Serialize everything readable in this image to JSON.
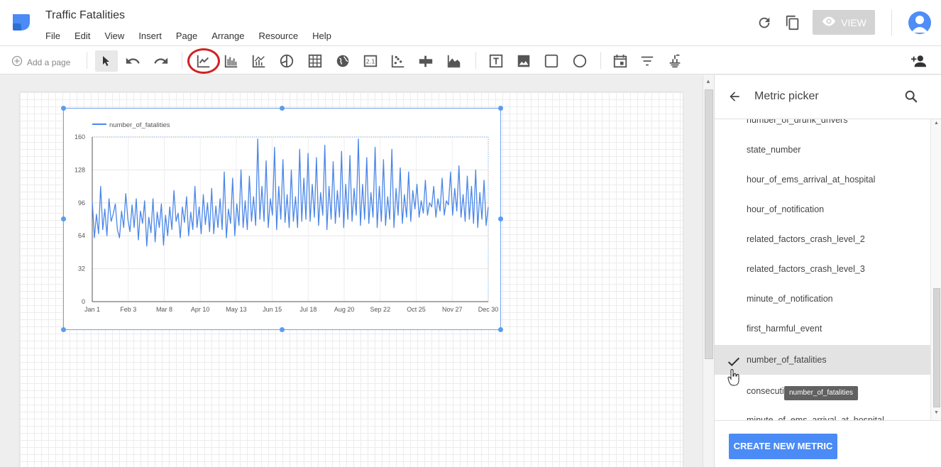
{
  "app": {
    "title": "Traffic Fatalities",
    "menu": [
      "File",
      "Edit",
      "View",
      "Insert",
      "Page",
      "Arrange",
      "Resource",
      "Help"
    ],
    "view_label": "VIEW"
  },
  "toolbar": {
    "add_page": "Add a page",
    "table_icon_text": "2.1"
  },
  "chart_data": {
    "type": "line",
    "legend": "number_of_fatalities",
    "yticks": [
      "160",
      "128",
      "96",
      "64",
      "32",
      "0"
    ],
    "xticks": [
      "Jan 1",
      "Feb 3",
      "Mar 8",
      "Apr 10",
      "May 13",
      "Jun 15",
      "Jul 18",
      "Aug 20",
      "Sep 22",
      "Oct 25",
      "Nov 27",
      "Dec 30"
    ],
    "ylim": [
      0,
      160
    ],
    "color": "#4a86e8",
    "series": [
      {
        "name": "number_of_fatalities",
        "values": [
          98,
          62,
          85,
          66,
          112,
          70,
          90,
          64,
          100,
          78,
          85,
          95,
          70,
          62,
          88,
          72,
          105,
          80,
          68,
          94,
          72,
          100,
          60,
          88,
          76,
          98,
          54,
          82,
          67,
          100,
          58,
          87,
          72,
          95,
          55,
          84,
          64,
          92,
          70,
          108,
          78,
          86,
          62,
          92,
          77,
          102,
          64,
          87,
          70,
          112,
          72,
          92,
          66,
          104,
          75,
          96,
          68,
          110,
          66,
          93,
          72,
          100,
          70,
          126,
          62,
          90,
          76,
          120,
          64,
          95,
          74,
          128,
          72,
          98,
          70,
          122,
          78,
          102,
          74,
          158,
          80,
          112,
          78,
          137,
          72,
          100,
          84,
          150,
          70,
          112,
          80,
          138,
          77,
          104,
          72,
          128,
          78,
          102,
          72,
          148,
          78,
          120,
          80,
          144,
          78,
          114,
          82,
          140,
          74,
          106,
          84,
          152,
          70,
          112,
          80,
          136,
          76,
          108,
          82,
          146,
          72,
          114,
          80,
          142,
          78,
          110,
          84,
          158,
          74,
          114,
          80,
          140,
          76,
          106,
          82,
          150,
          72,
          112,
          78,
          138,
          74,
          102,
          80,
          148,
          72,
          110,
          84,
          130,
          76,
          104,
          82,
          126,
          78,
          108,
          90,
          114,
          82,
          98,
          86,
          118,
          84,
          96,
          92,
          112,
          82,
          100,
          88,
          120,
          84,
          98,
          94,
          126,
          84,
          110,
          88,
          132,
          82,
          104,
          78,
          122,
          80,
          112,
          76,
          128,
          72,
          106,
          80,
          118,
          74,
          92
        ]
      }
    ]
  },
  "panel": {
    "title": "Metric picker",
    "metrics": [
      "number_of_drunk_drivers",
      "state_number",
      "hour_of_ems_arrival_at_hospital",
      "hour_of_notification",
      "related_factors_crash_level_2",
      "related_factors_crash_level_3",
      "minute_of_notification",
      "first_harmful_event",
      "number_of_fatalities",
      "consecutive_number",
      "minute_of_ems_arrival_at_hospital"
    ],
    "selected_index": 8,
    "tooltip": "number_of_fatalities",
    "create_label": "CREATE NEW METRIC"
  }
}
